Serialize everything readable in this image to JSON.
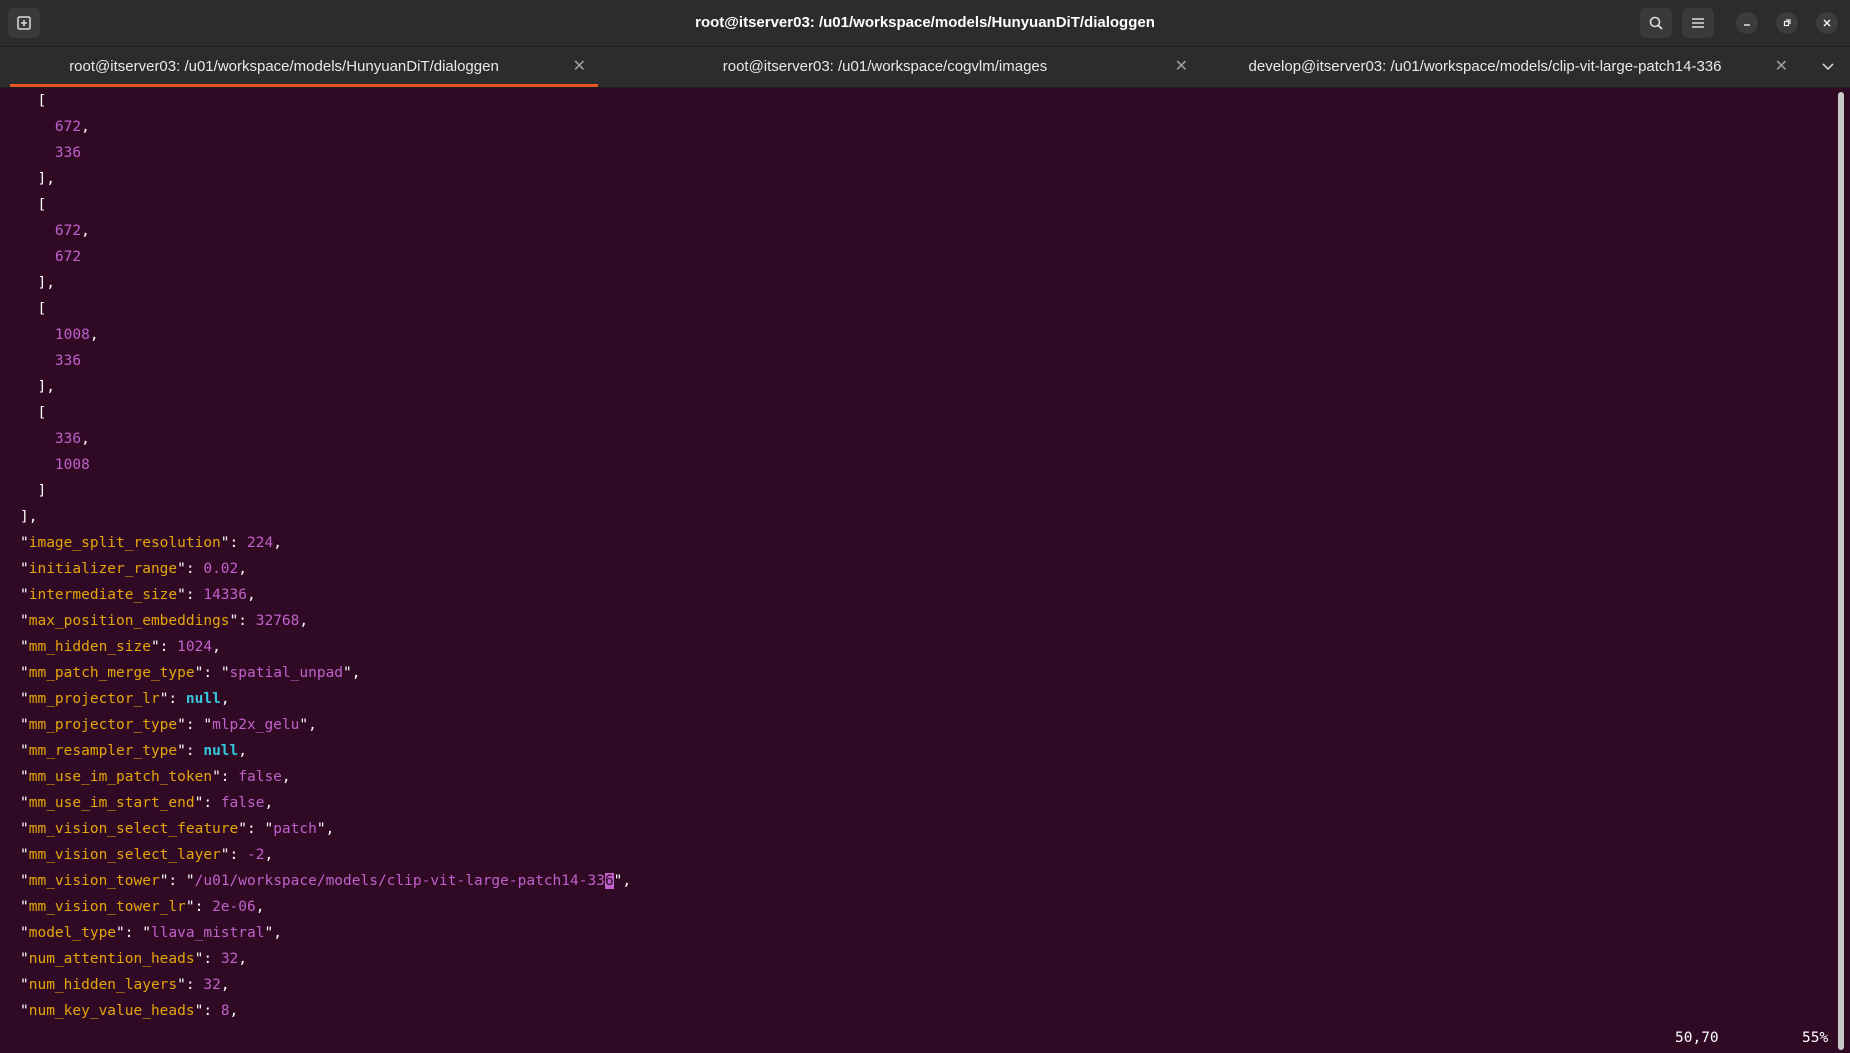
{
  "window": {
    "title": "root@itserver03: /u01/workspace/models/HunyuanDiT/dialoggen"
  },
  "tabs": [
    {
      "label": "root@itserver03: /u01/workspace/models/HunyuanDiT/dialoggen",
      "active": true
    },
    {
      "label": "root@itserver03: /u01/workspace/cogvlm/images",
      "active": false
    },
    {
      "label": "develop@itserver03: /u01/workspace/models/clip-vit-large-patch14-336",
      "active": false
    }
  ],
  "icons": {
    "new_tab": "new-tab-icon",
    "search": "search-icon",
    "menu": "hamburger-menu-icon",
    "minimize": "minimize-icon",
    "maximize": "maximize-icon",
    "close": "close-icon",
    "tab_close": "close-icon",
    "tab_list": "chevron-down-icon"
  },
  "colors": {
    "background": "#300a24",
    "key": "#e5a50a",
    "value": "#c061cb",
    "null": "#33c7de",
    "accent": "#e95420"
  },
  "lines": [
    {
      "indent": "  ",
      "text": "["
    },
    {
      "indent": "    ",
      "num": "672",
      "trail": ","
    },
    {
      "indent": "    ",
      "num": "336",
      "trail": ""
    },
    {
      "indent": "  ",
      "text": "],"
    },
    {
      "indent": "  ",
      "text": "["
    },
    {
      "indent": "    ",
      "num": "672",
      "trail": ","
    },
    {
      "indent": "    ",
      "num": "672",
      "trail": ""
    },
    {
      "indent": "  ",
      "text": "],"
    },
    {
      "indent": "  ",
      "text": "["
    },
    {
      "indent": "    ",
      "num": "1008",
      "trail": ","
    },
    {
      "indent": "    ",
      "num": "336",
      "trail": ""
    },
    {
      "indent": "  ",
      "text": "],"
    },
    {
      "indent": "  ",
      "text": "["
    },
    {
      "indent": "    ",
      "num": "336",
      "trail": ","
    },
    {
      "indent": "    ",
      "num": "1008",
      "trail": ""
    },
    {
      "indent": "  ",
      "text": "]"
    },
    {
      "indent": "",
      "text": "],"
    },
    {
      "key": "image_split_resolution",
      "num": "224"
    },
    {
      "key": "initializer_range",
      "num": "0.02"
    },
    {
      "key": "intermediate_size",
      "num": "14336"
    },
    {
      "key": "max_position_embeddings",
      "num": "32768"
    },
    {
      "key": "mm_hidden_size",
      "num": "1024"
    },
    {
      "key": "mm_patch_merge_type",
      "str": "spatial_unpad"
    },
    {
      "key": "mm_projector_lr",
      "null": "null"
    },
    {
      "key": "mm_projector_type",
      "str": "mlp2x_gelu"
    },
    {
      "key": "mm_resampler_type",
      "null": "null"
    },
    {
      "key": "mm_use_im_patch_token",
      "num": "false"
    },
    {
      "key": "mm_use_im_start_end",
      "num": "false"
    },
    {
      "key": "mm_vision_select_feature",
      "str": "patch"
    },
    {
      "key": "mm_vision_select_layer",
      "num": "-2"
    },
    {
      "key": "mm_vision_tower",
      "str": "/u01/workspace/models/clip-vit-large-patch14-33",
      "cursor_char": "6"
    },
    {
      "key": "mm_vision_tower_lr",
      "num": "2e-06"
    },
    {
      "key": "model_type",
      "str": "llava_mistral"
    },
    {
      "key": "num_attention_heads",
      "num": "32"
    },
    {
      "key": "num_hidden_layers",
      "num": "32"
    },
    {
      "key": "num_key_value_heads",
      "num": "8"
    }
  ],
  "status": {
    "position": "50,70",
    "percent": "55%"
  }
}
